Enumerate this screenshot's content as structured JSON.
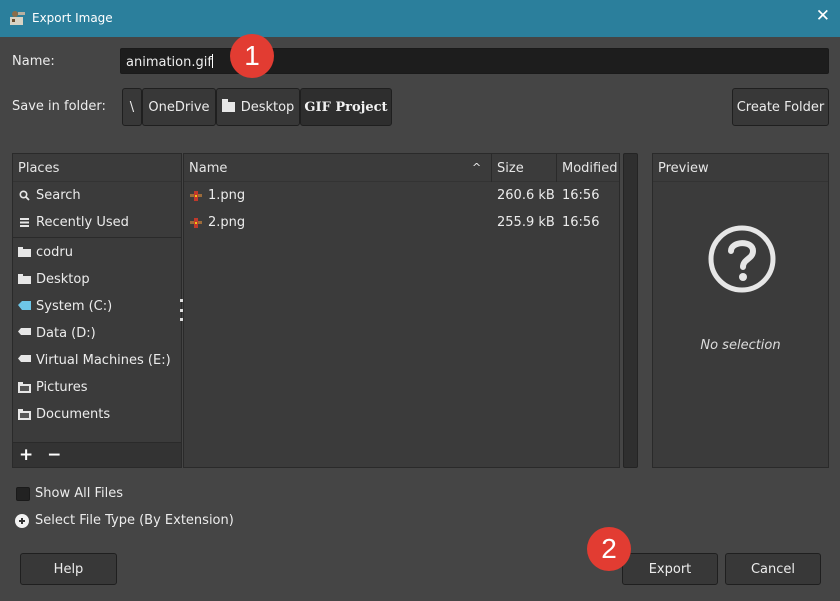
{
  "window": {
    "title": "Export Image",
    "close_glyph": "✕"
  },
  "name_field": {
    "label": "Name:",
    "value": "animation.gif"
  },
  "save_in": {
    "label": "Save in folder:",
    "path": [
      "\\",
      "OneDrive",
      "Desktop",
      "GIF Project"
    ],
    "create_folder": "Create Folder"
  },
  "places": {
    "header": "Places",
    "items": [
      {
        "label": "Search",
        "icon": "search-icon"
      },
      {
        "label": "Recently Used",
        "icon": "recent-icon"
      },
      {
        "label": "codru",
        "icon": "folder-icon"
      },
      {
        "label": "Desktop",
        "icon": "folder-icon"
      },
      {
        "label": "System (C:)",
        "icon": "drive-icon"
      },
      {
        "label": "Data (D:)",
        "icon": "drive-icon"
      },
      {
        "label": "Virtual Machines (E:)",
        "icon": "drive-icon"
      },
      {
        "label": "Pictures",
        "icon": "folder-icon"
      },
      {
        "label": "Documents",
        "icon": "folder-icon"
      }
    ],
    "add_remove": "+ −"
  },
  "files": {
    "columns": {
      "name": "Name",
      "size": "Size",
      "modified": "Modified"
    },
    "sort_indicator": "^",
    "rows": [
      {
        "name": "1.png",
        "size": "260.6 kB",
        "modified": "16:56"
      },
      {
        "name": "2.png",
        "size": "255.9 kB",
        "modified": "16:56"
      }
    ]
  },
  "preview": {
    "header": "Preview",
    "empty_text": "No selection"
  },
  "options": {
    "show_all_files": "Show All Files",
    "select_file_type": "Select File Type (By Extension)"
  },
  "buttons": {
    "help": "Help",
    "export": "Export",
    "cancel": "Cancel"
  },
  "annotations": {
    "step1": "1",
    "step2": "2"
  },
  "colors": {
    "titlebar": "#2b7f9c",
    "badge": "#e23c32",
    "dialog_bg": "#454545"
  }
}
